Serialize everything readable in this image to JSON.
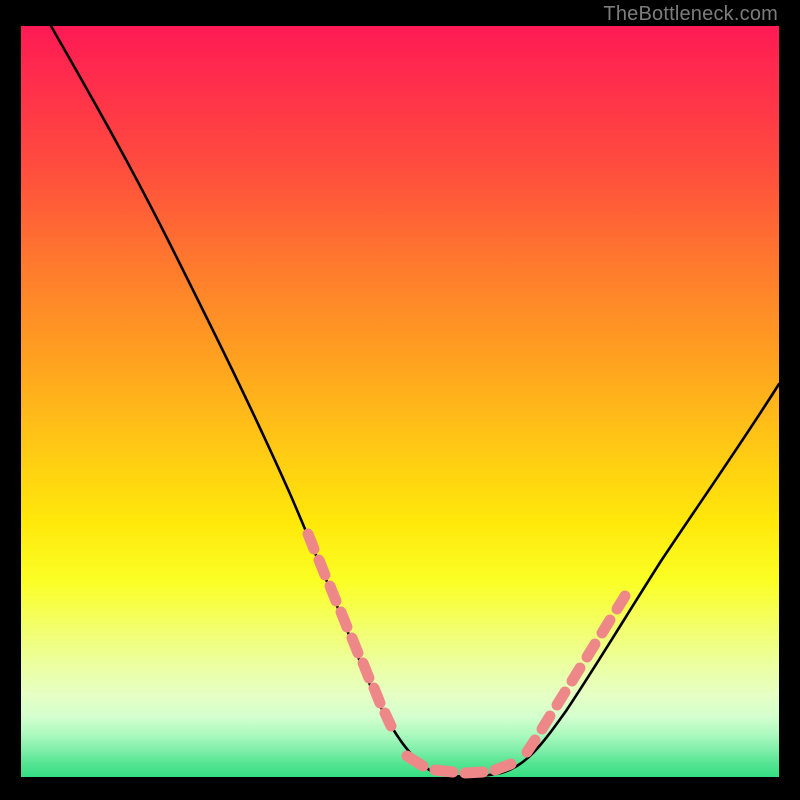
{
  "watermark": "TheBottleneck.com",
  "chart_data": {
    "type": "line",
    "title": "",
    "xlabel": "",
    "ylabel": "",
    "xlim": [
      0,
      100
    ],
    "ylim": [
      0,
      100
    ],
    "grid": false,
    "legend": false,
    "series": [
      {
        "name": "curve",
        "color": "#000000",
        "x": [
          4,
          10,
          15,
          20,
          25,
          30,
          35,
          40,
          45,
          48,
          50,
          53,
          56,
          60,
          63,
          65,
          70,
          75,
          80,
          85,
          90,
          95,
          100
        ],
        "values": [
          100,
          91,
          83,
          75,
          66,
          57,
          47,
          37,
          26,
          18,
          12,
          6,
          2,
          0,
          0,
          2,
          8,
          15,
          23,
          31,
          39,
          46,
          53
        ]
      },
      {
        "name": "highlight-dots",
        "color": "#e57373",
        "style": "dashed-markers",
        "x": [
          38,
          39.5,
          41,
          42.5,
          44,
          45.5,
          50,
          52.5,
          55,
          57.5,
          60,
          62.5,
          65,
          66.5,
          68,
          69.5,
          71,
          72.5,
          74
        ],
        "values": [
          22,
          19,
          16,
          13,
          10,
          7,
          2,
          1,
          0.5,
          0.5,
          0.5,
          1,
          2,
          4,
          6.5,
          9,
          11.5,
          14,
          16.5
        ]
      }
    ]
  },
  "colors": {
    "background": "#000000",
    "gradient_top": "#ff1a55",
    "gradient_bottom": "#34de82",
    "curve": "#000000",
    "dots": "#e57373",
    "watermark": "#7c7c7c"
  }
}
